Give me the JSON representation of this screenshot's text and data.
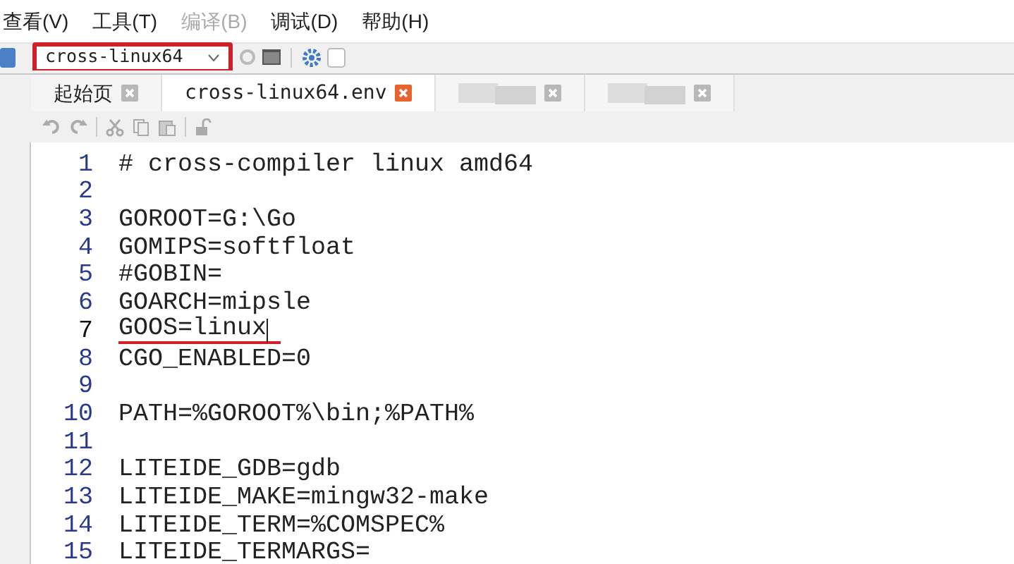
{
  "menu": [
    {
      "label": "查看(V)",
      "disabled": false
    },
    {
      "label": "工具(T)",
      "disabled": false
    },
    {
      "label": "编译(B)",
      "disabled": true
    },
    {
      "label": "调试(D)",
      "disabled": false
    },
    {
      "label": "帮助(H)",
      "disabled": false
    }
  ],
  "toolbar": {
    "environment": {
      "value": "cross-linux64",
      "highlighted": true
    }
  },
  "tabs": [
    {
      "kind": "text",
      "label": "起始页",
      "selected": false
    },
    {
      "kind": "text",
      "label": "cross-linux64.env",
      "selected": true
    },
    {
      "kind": "blurred",
      "selected": false
    },
    {
      "kind": "blurred",
      "selected": false
    }
  ],
  "editor": {
    "lines": [
      {
        "number": "1",
        "text": "# cross-compiler linux amd64",
        "current": false,
        "underlined": false
      },
      {
        "number": "2",
        "current": false
      },
      {
        "number": "3",
        "text": "GOROOT=G:\\Go",
        "current": false,
        "underlined": false
      },
      {
        "number": "4",
        "text": "GOMIPS=softfloat",
        "current": false,
        "underlined": false
      },
      {
        "number": "5",
        "text": "#GOBIN=",
        "current": false,
        "underlined": false
      },
      {
        "number": "6",
        "text": "GOARCH=mipsle",
        "current": false,
        "underlined": false
      },
      {
        "number": "7",
        "text": "GOOS=linux",
        "current": true,
        "underlined": true
      },
      {
        "number": "8",
        "text": "CGO_ENABLED=0",
        "current": false,
        "underlined": false
      },
      {
        "number": "9",
        "current": false
      },
      {
        "number": "10",
        "text": "PATH=%GOROOT%\\bin;%PATH%",
        "current": false,
        "underlined": false
      },
      {
        "number": "11",
        "current": false
      },
      {
        "number": "12",
        "text": "LITEIDE_GDB=gdb",
        "current": false,
        "underlined": false
      },
      {
        "number": "13",
        "text": "LITEIDE_MAKE=mingw32-make",
        "current": false,
        "underlined": false
      },
      {
        "number": "14",
        "text": "LITEIDE_TERM=%COMSPEC%",
        "current": false,
        "underlined": false
      },
      {
        "number": "15",
        "text": "LITEIDE_TERMARGS=",
        "current": false,
        "underlined": false
      }
    ]
  }
}
